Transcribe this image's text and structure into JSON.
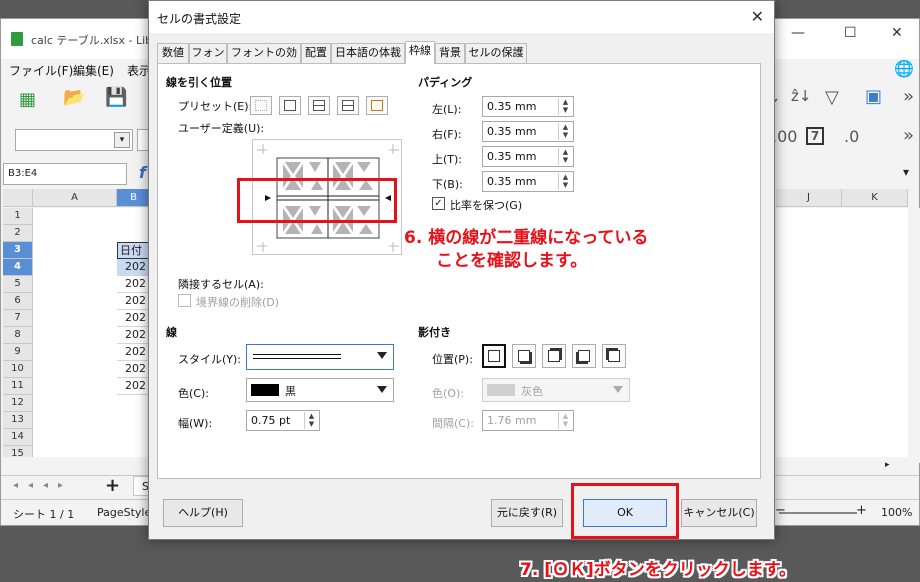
{
  "calc": {
    "title": "calc テーブル.xlsx - Libre",
    "menu": [
      "ファイル(F)",
      "編集(E)",
      "表示"
    ],
    "namebox": "B3:E4",
    "fx": "f",
    "columns_left": [
      "A",
      "B"
    ],
    "columns_right": [
      "J",
      "K"
    ],
    "rows": [
      "1",
      "2",
      "3",
      "4",
      "5",
      "6",
      "7",
      "8",
      "9",
      "10",
      "11",
      "12",
      "13",
      "14",
      "15"
    ],
    "header_cell": "日付",
    "cell_values": [
      "202",
      "202",
      "202",
      "202",
      "202",
      "202",
      "202",
      "202"
    ],
    "sheet_tab_partial": "S",
    "status_sheet": "シート 1 / 1",
    "status_pagestyle": "PageStyle",
    "zoom": "100%",
    "icon_7": "7"
  },
  "dialog": {
    "title": "セルの書式設定",
    "tabs": [
      "数値",
      "フォント",
      "フォントの効果",
      "配置",
      "日本語の体裁",
      "枠線",
      "背景",
      "セルの保護"
    ],
    "active_tab": "枠線",
    "line_arrangement": {
      "title": "線を引く位置",
      "preset_label": "プリセット(E):",
      "user_defined_label": "ユーザー定義(U):",
      "adjacent_cells_label": "隣接するセル(A):",
      "remove_border_label": "境界線の削除(D)"
    },
    "padding": {
      "title": "パディング",
      "left_label": "左(L):",
      "left_value": "0.35 mm",
      "right_label": "右(F):",
      "right_value": "0.35 mm",
      "top_label": "上(T):",
      "top_value": "0.35 mm",
      "bottom_label": "下(B):",
      "bottom_value": "0.35 mm",
      "sync_label": "比率を保つ(G)"
    },
    "line": {
      "title": "線",
      "style_label": "スタイル(Y):",
      "color_label": "色(C):",
      "color_value": "黒",
      "width_label": "幅(W):",
      "width_value": "0.75 pt"
    },
    "shadow": {
      "title": "影付き",
      "position_label": "位置(P):",
      "color_label": "色(O):",
      "color_value": "灰色",
      "distance_label": "間隔(C):",
      "distance_value": "1.76 mm"
    },
    "buttons": {
      "help": "ヘルプ(H)",
      "reset": "元に戻す(R)",
      "ok": "OK",
      "cancel": "キャンセル(C)"
    }
  },
  "annotations": {
    "step6_line1": "6. 横の線が二重線になっている",
    "step6_line2": "ことを確認します。",
    "step7": "7. [ＯＫ]ボタンをクリックします。"
  },
  "colors": {
    "annotation_red": "#e8111a",
    "selection_blue": "#5a8fd8",
    "focus_blue": "#3a78d6"
  }
}
